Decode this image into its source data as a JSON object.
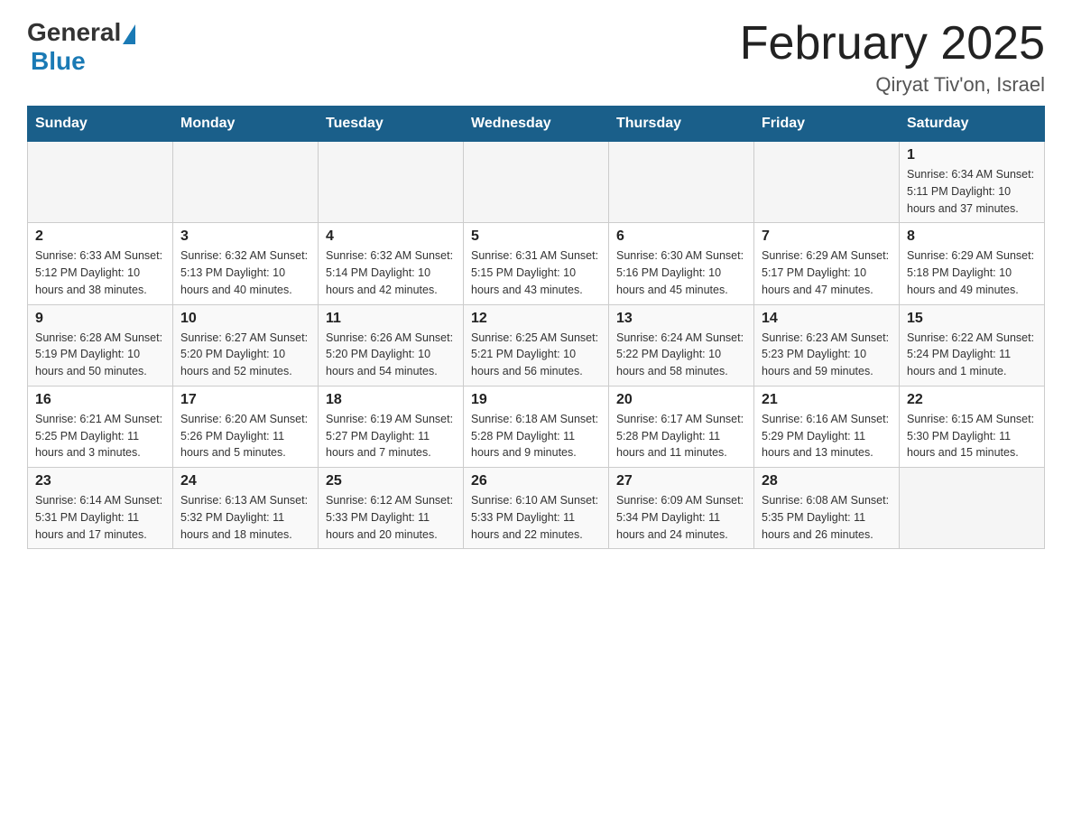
{
  "header": {
    "logo_general": "General",
    "logo_blue": "Blue",
    "title": "February 2025",
    "subtitle": "Qiryat Tiv'on, Israel"
  },
  "days_of_week": [
    "Sunday",
    "Monday",
    "Tuesday",
    "Wednesday",
    "Thursday",
    "Friday",
    "Saturday"
  ],
  "weeks": [
    [
      {
        "day": "",
        "info": ""
      },
      {
        "day": "",
        "info": ""
      },
      {
        "day": "",
        "info": ""
      },
      {
        "day": "",
        "info": ""
      },
      {
        "day": "",
        "info": ""
      },
      {
        "day": "",
        "info": ""
      },
      {
        "day": "1",
        "info": "Sunrise: 6:34 AM\nSunset: 5:11 PM\nDaylight: 10 hours and 37 minutes."
      }
    ],
    [
      {
        "day": "2",
        "info": "Sunrise: 6:33 AM\nSunset: 5:12 PM\nDaylight: 10 hours and 38 minutes."
      },
      {
        "day": "3",
        "info": "Sunrise: 6:32 AM\nSunset: 5:13 PM\nDaylight: 10 hours and 40 minutes."
      },
      {
        "day": "4",
        "info": "Sunrise: 6:32 AM\nSunset: 5:14 PM\nDaylight: 10 hours and 42 minutes."
      },
      {
        "day": "5",
        "info": "Sunrise: 6:31 AM\nSunset: 5:15 PM\nDaylight: 10 hours and 43 minutes."
      },
      {
        "day": "6",
        "info": "Sunrise: 6:30 AM\nSunset: 5:16 PM\nDaylight: 10 hours and 45 minutes."
      },
      {
        "day": "7",
        "info": "Sunrise: 6:29 AM\nSunset: 5:17 PM\nDaylight: 10 hours and 47 minutes."
      },
      {
        "day": "8",
        "info": "Sunrise: 6:29 AM\nSunset: 5:18 PM\nDaylight: 10 hours and 49 minutes."
      }
    ],
    [
      {
        "day": "9",
        "info": "Sunrise: 6:28 AM\nSunset: 5:19 PM\nDaylight: 10 hours and 50 minutes."
      },
      {
        "day": "10",
        "info": "Sunrise: 6:27 AM\nSunset: 5:20 PM\nDaylight: 10 hours and 52 minutes."
      },
      {
        "day": "11",
        "info": "Sunrise: 6:26 AM\nSunset: 5:20 PM\nDaylight: 10 hours and 54 minutes."
      },
      {
        "day": "12",
        "info": "Sunrise: 6:25 AM\nSunset: 5:21 PM\nDaylight: 10 hours and 56 minutes."
      },
      {
        "day": "13",
        "info": "Sunrise: 6:24 AM\nSunset: 5:22 PM\nDaylight: 10 hours and 58 minutes."
      },
      {
        "day": "14",
        "info": "Sunrise: 6:23 AM\nSunset: 5:23 PM\nDaylight: 10 hours and 59 minutes."
      },
      {
        "day": "15",
        "info": "Sunrise: 6:22 AM\nSunset: 5:24 PM\nDaylight: 11 hours and 1 minute."
      }
    ],
    [
      {
        "day": "16",
        "info": "Sunrise: 6:21 AM\nSunset: 5:25 PM\nDaylight: 11 hours and 3 minutes."
      },
      {
        "day": "17",
        "info": "Sunrise: 6:20 AM\nSunset: 5:26 PM\nDaylight: 11 hours and 5 minutes."
      },
      {
        "day": "18",
        "info": "Sunrise: 6:19 AM\nSunset: 5:27 PM\nDaylight: 11 hours and 7 minutes."
      },
      {
        "day": "19",
        "info": "Sunrise: 6:18 AM\nSunset: 5:28 PM\nDaylight: 11 hours and 9 minutes."
      },
      {
        "day": "20",
        "info": "Sunrise: 6:17 AM\nSunset: 5:28 PM\nDaylight: 11 hours and 11 minutes."
      },
      {
        "day": "21",
        "info": "Sunrise: 6:16 AM\nSunset: 5:29 PM\nDaylight: 11 hours and 13 minutes."
      },
      {
        "day": "22",
        "info": "Sunrise: 6:15 AM\nSunset: 5:30 PM\nDaylight: 11 hours and 15 minutes."
      }
    ],
    [
      {
        "day": "23",
        "info": "Sunrise: 6:14 AM\nSunset: 5:31 PM\nDaylight: 11 hours and 17 minutes."
      },
      {
        "day": "24",
        "info": "Sunrise: 6:13 AM\nSunset: 5:32 PM\nDaylight: 11 hours and 18 minutes."
      },
      {
        "day": "25",
        "info": "Sunrise: 6:12 AM\nSunset: 5:33 PM\nDaylight: 11 hours and 20 minutes."
      },
      {
        "day": "26",
        "info": "Sunrise: 6:10 AM\nSunset: 5:33 PM\nDaylight: 11 hours and 22 minutes."
      },
      {
        "day": "27",
        "info": "Sunrise: 6:09 AM\nSunset: 5:34 PM\nDaylight: 11 hours and 24 minutes."
      },
      {
        "day": "28",
        "info": "Sunrise: 6:08 AM\nSunset: 5:35 PM\nDaylight: 11 hours and 26 minutes."
      },
      {
        "day": "",
        "info": ""
      }
    ]
  ]
}
